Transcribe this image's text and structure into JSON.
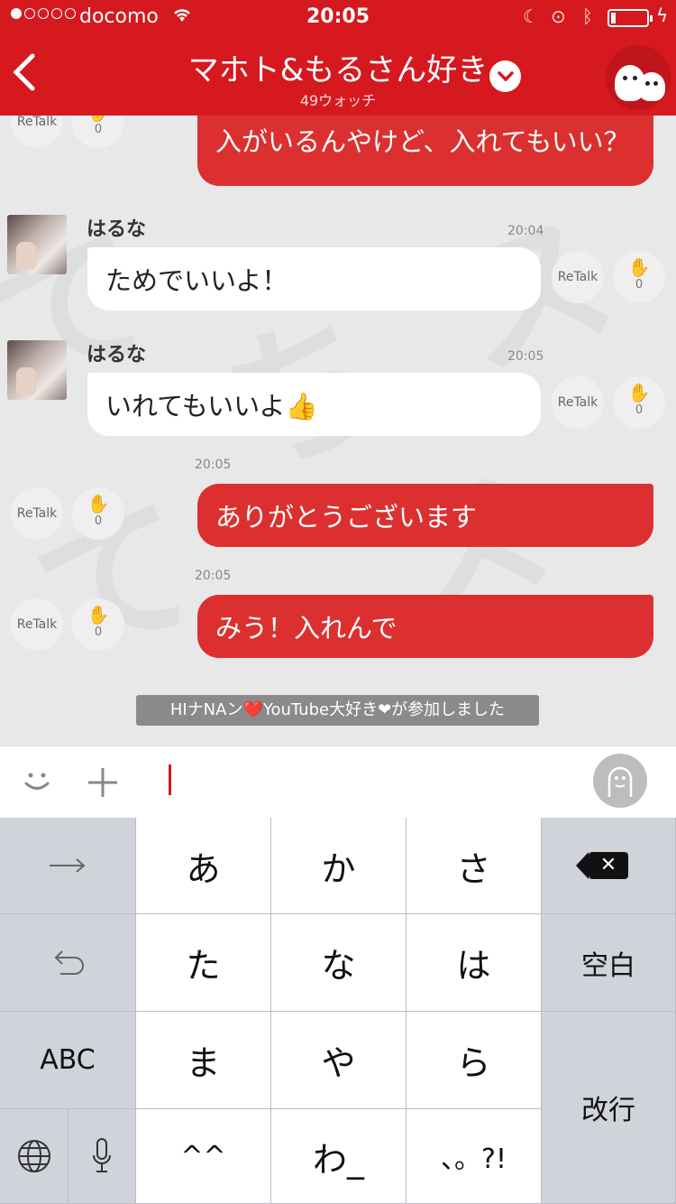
{
  "status_bar": {
    "carrier": "docomo",
    "time": "20:05",
    "wifi_icon": "wifi-icon",
    "moon_icon": "moon-icon",
    "lock_icon": "rotation-lock-icon",
    "bluetooth_icon": "bluetooth-icon",
    "charging_icon": "charging-icon"
  },
  "header": {
    "back_icon": "chevron-left-icon",
    "title": "マホト&もるさん好き",
    "watch_count": "49ウォッチ",
    "dropdown_icon": "chevron-down-icon",
    "mascot_icon": "mascot-icon",
    "bg_color": "#d5191f"
  },
  "messages": [
    {
      "side": "out",
      "text": "入がいるんやけど、入れてもいい？",
      "retalk": "ReTalk",
      "claps": "0"
    },
    {
      "side": "in",
      "sender": "はるな",
      "time": "20:04",
      "text": "ためでいいよ！",
      "retalk": "ReTalk",
      "claps": "0"
    },
    {
      "side": "in",
      "sender": "はるな",
      "time": "20:05",
      "text": "いれてもいいよ👍",
      "retalk": "ReTalk",
      "claps": "0"
    },
    {
      "side": "out",
      "time": "20:05",
      "text": "ありがとうございます",
      "retalk": "ReTalk",
      "claps": "0"
    },
    {
      "side": "out",
      "time": "20:05",
      "text": "みう！入れんで",
      "retalk": "ReTalk",
      "claps": "0"
    }
  ],
  "join_notice": "HIナNAン❤️YouTube大好き❤が参加しました",
  "input": {
    "emoji_icon": "smile-icon",
    "plus_icon": "plus-icon",
    "stamp_icon": "stamp-face-icon"
  },
  "keyboard": {
    "row1": [
      "→",
      "あ",
      "か",
      "さ",
      "⌫"
    ],
    "row2": [
      "↩",
      "た",
      "な",
      "は",
      "空白"
    ],
    "row3": [
      "ABC",
      "ま",
      "や",
      "ら",
      "改行"
    ],
    "row4": [
      "🌐",
      "🎤",
      "^^",
      "わ_",
      "、。?!"
    ]
  }
}
